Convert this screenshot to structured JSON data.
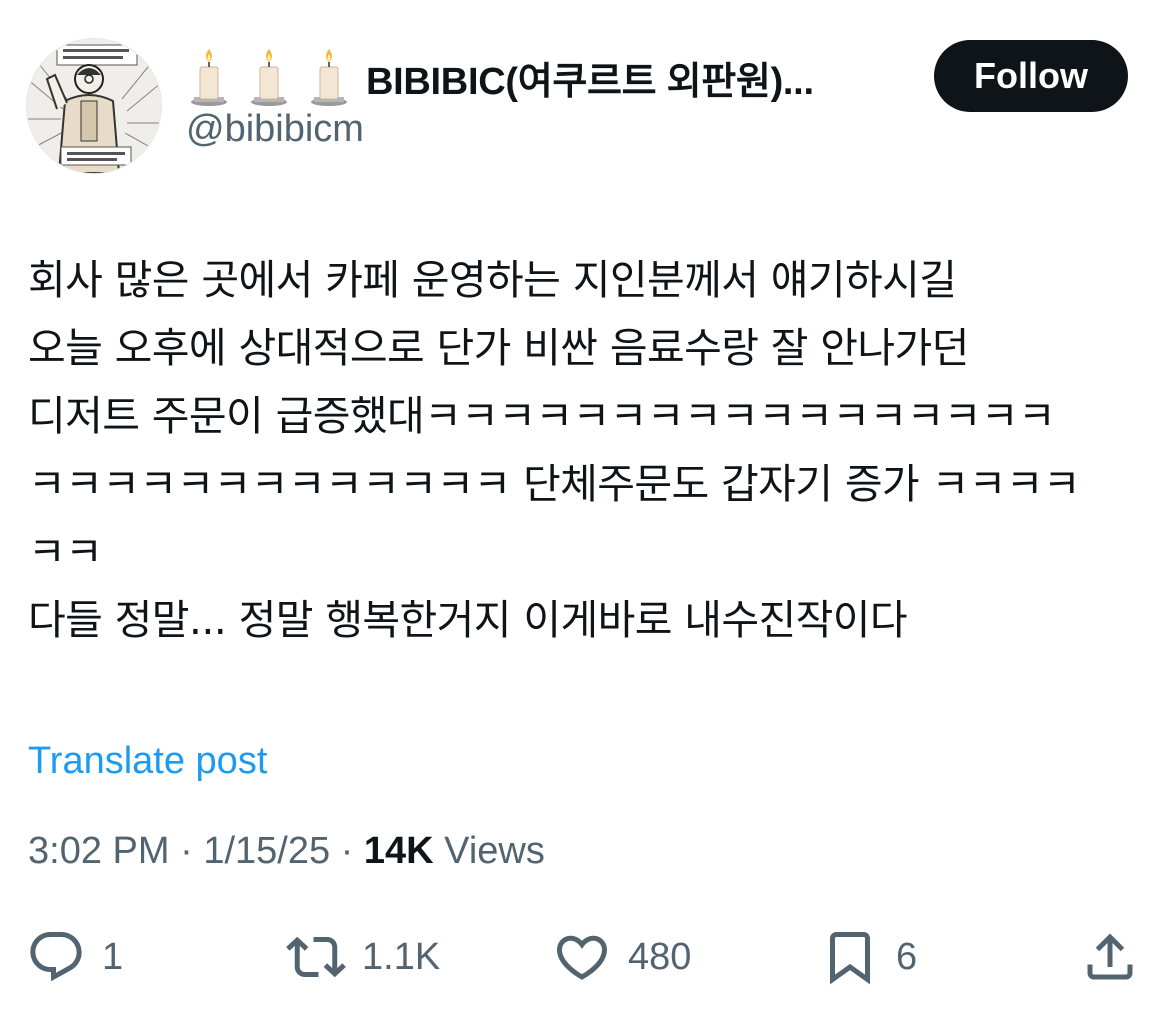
{
  "author": {
    "display_name": "BIBIBIC(여쿠르트 외판원)...",
    "handle": "@bibibicm",
    "emoji_icons": [
      "candle-icon",
      "candle-icon",
      "candle-icon"
    ]
  },
  "follow_button": {
    "label": "Follow"
  },
  "post": {
    "lines": [
      "회사 많은 곳에서 카페 운영하는 지인분께서 얘기하시길",
      "오늘 오후에 상대적으로 단가 비싼 음료수랑 잘 안나가던",
      "디저트 주문이 급증했대ㅋㅋㅋㅋㅋㅋㅋㅋㅋㅋㅋㅋㅋㅋㅋㅋㅋ",
      "ㅋㅋㅋㅋㅋㅋㅋㅋㅋㅋㅋㅋㅋ 단체주문도 갑자기 증가 ㅋㅋㅋㅋ",
      "ㅋㅋ",
      "다들 정말... 정말 행복한거지 이게바로 내수진작이다"
    ]
  },
  "translate_link": "Translate post",
  "meta": {
    "time": "3:02 PM",
    "separator": " · ",
    "date": "1/15/25",
    "views_count": "14K",
    "views_label": " Views"
  },
  "actions": {
    "reply_count": "1",
    "repost_count": "1.1K",
    "like_count": "480",
    "bookmark_count": "6"
  },
  "colors": {
    "text_primary": "#0f1419",
    "text_secondary": "#536471",
    "link": "#1d9bf0",
    "follow_bg": "#0f1419"
  }
}
